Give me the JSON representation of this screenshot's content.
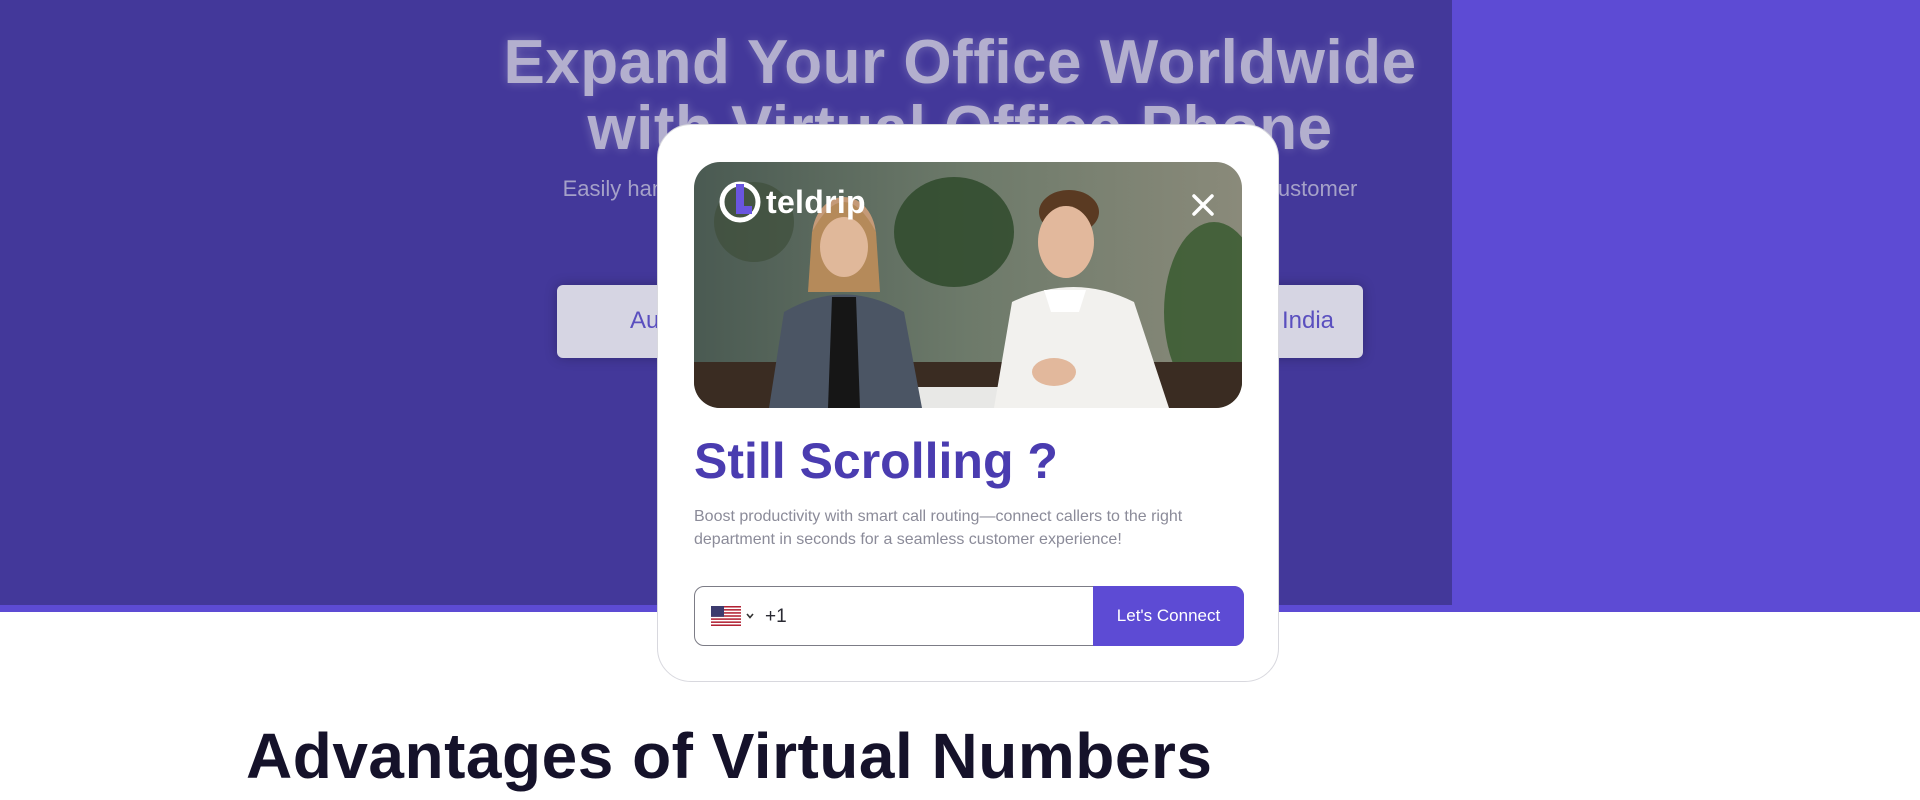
{
  "hero": {
    "title": "Expand Your Office Worldwide with Virtual Office Phone Numbers",
    "subtitle_left": "Easily handle",
    "subtitle_right": "r customer",
    "country_left": "Au",
    "country_right": "India"
  },
  "section": {
    "title": "Advantages of Virtual Numbers"
  },
  "modal": {
    "brand_name": "teldrip",
    "close_icon": "close-icon",
    "heading": "Still Scrolling ?",
    "description": "Boost productivity with smart call routing—connect callers to the right department in seconds for a seamless customer experience!",
    "phone": {
      "country_flag": "us-flag-icon",
      "dial_code": "+1",
      "value": ""
    },
    "submit_label": "Let's Connect"
  },
  "colors": {
    "brand_purple": "#5d4bd4",
    "hero_dark": "#43389a",
    "heading_purple": "#4a3cb0"
  }
}
